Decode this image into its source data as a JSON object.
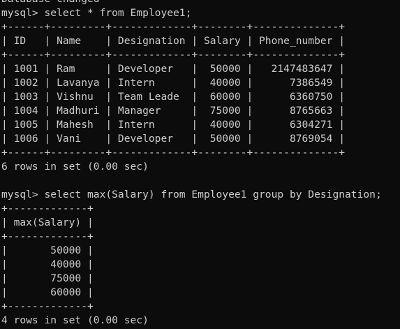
{
  "terminal": {
    "lines": [
      "Database changed",
      "mysql> select * from Employee1;",
      "+------+---------+-------------+--------+--------------+",
      "| ID   | Name    | Designation | Salary | Phone_number |",
      "+------+---------+-------------+--------+--------------+",
      "| 1001 | Ram     | Developer   |  50000 |   2147483647 |",
      "| 1002 | Lavanya | Intern      |  40000 |      7386549 |",
      "| 1003 | Vishnu  | Team Leade  |  60000 |      6360750 |",
      "| 1004 | Madhuri | Manager     |  75000 |      8765663 |",
      "| 1005 | Mahesh  | Intern      |  40000 |      6304271 |",
      "| 1006 | Vani    | Developer   |  50000 |      8769054 |",
      "+------+---------+-------------+--------+--------------+",
      "6 rows in set (0.00 sec)",
      "",
      "mysql> select max(Salary) from Employee1 group by Designation;",
      "+-------------+",
      "| max(Salary) |",
      "+-------------+",
      "|       50000 |",
      "|       40000 |",
      "|       75000 |",
      "|       60000 |",
      "+-------------+",
      "4 rows in set (0.00 sec)"
    ]
  }
}
